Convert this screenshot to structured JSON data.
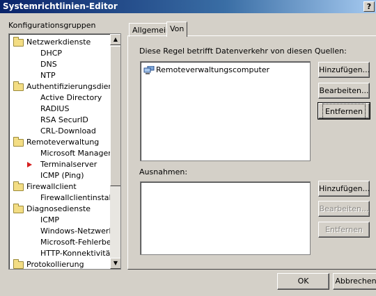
{
  "window": {
    "title": "Systemrichtlinien-Editor",
    "help_label": "?"
  },
  "groups": {
    "label": "Konfigurationsgruppen",
    "items": [
      {
        "label": "Netzwerkdienste",
        "type": "folder"
      },
      {
        "label": "DHCP",
        "type": "leaf"
      },
      {
        "label": "DNS",
        "type": "leaf"
      },
      {
        "label": "NTP",
        "type": "leaf"
      },
      {
        "label": "Authentifizierungsdienste",
        "type": "folder"
      },
      {
        "label": "Active Directory",
        "type": "leaf"
      },
      {
        "label": "RADIUS",
        "type": "leaf"
      },
      {
        "label": "RSA SecurID",
        "type": "leaf"
      },
      {
        "label": "CRL-Download",
        "type": "leaf"
      },
      {
        "label": "Remoteverwaltung",
        "type": "folder"
      },
      {
        "label": "Microsoft Management Console",
        "type": "leaf"
      },
      {
        "label": "Terminalserver",
        "type": "leaf",
        "selected": true
      },
      {
        "label": "ICMP (Ping)",
        "type": "leaf"
      },
      {
        "label": "Firewallclient",
        "type": "folder"
      },
      {
        "label": "Firewallclientinstallation",
        "type": "leaf"
      },
      {
        "label": "Diagnosedienste",
        "type": "folder"
      },
      {
        "label": "ICMP",
        "type": "leaf"
      },
      {
        "label": "Windows-Netzwerk",
        "type": "leaf"
      },
      {
        "label": "Microsoft-Fehlerberichterstattung",
        "type": "leaf"
      },
      {
        "label": "HTTP-Konnektivitätsüberprüfung",
        "type": "leaf"
      },
      {
        "label": "Protokollierung",
        "type": "folder"
      }
    ]
  },
  "tabs": [
    {
      "label": "Allgemein"
    },
    {
      "label": "Von",
      "active": true
    }
  ],
  "sources": {
    "label": "Diese Regel betrifft Datenverkehr von diesen Quellen:",
    "items": [
      "Remoteverwaltungscomputer"
    ],
    "add_label": "Hinzufügen...",
    "edit_label": "Bearbeiten...",
    "remove_label": "Entfernen"
  },
  "exceptions": {
    "label": "Ausnahmen:",
    "items": [],
    "add_label": "Hinzufügen...",
    "edit_label": "Bearbeiten...",
    "remove_label": "Entfernen"
  },
  "footer": {
    "ok_label": "OK",
    "cancel_label": "Abbrechen"
  },
  "icons": {
    "folder": "folder-icon",
    "selection_arrow": "red-arrow-icon",
    "computer": "computer-group-icon",
    "scroll_up": "scroll-up-icon",
    "scroll_down": "scroll-down-icon"
  }
}
